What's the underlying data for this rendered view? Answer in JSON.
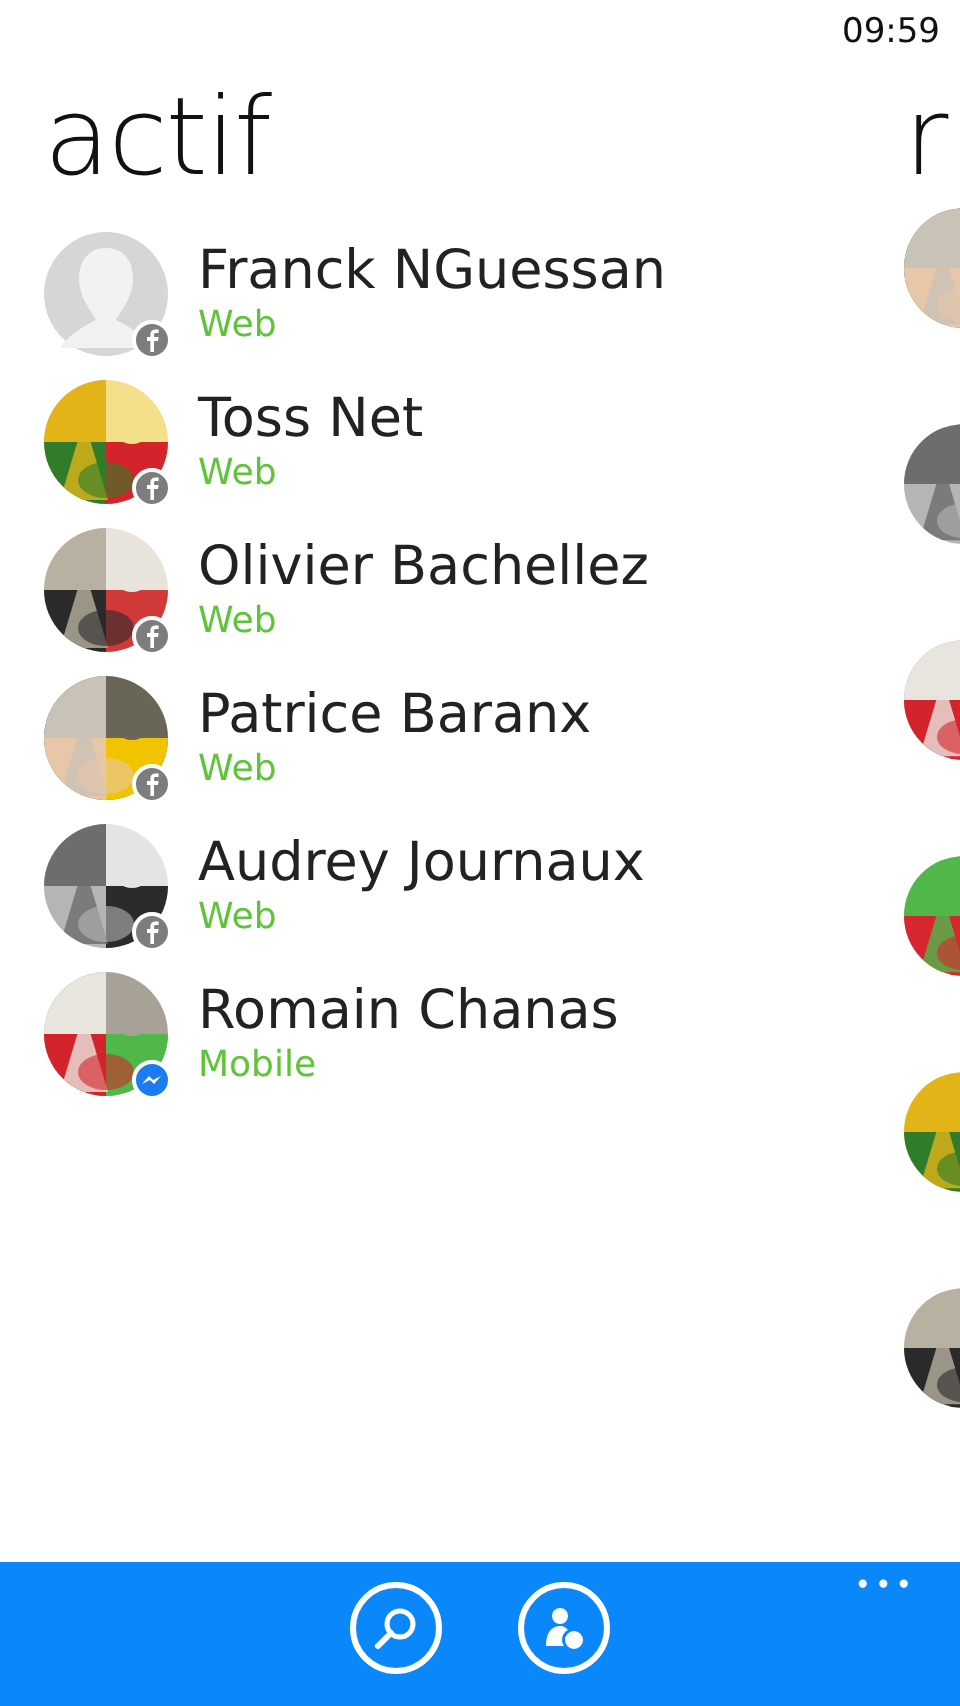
{
  "status_bar": {
    "time": "09:59"
  },
  "pivots": [
    {
      "header": "actif",
      "contacts": [
        {
          "name": "Franck NGuessan",
          "presence": "Web",
          "avatar": {
            "kind": "placeholder"
          },
          "badge": {
            "kind": "facebook"
          }
        },
        {
          "name": "Toss Net",
          "presence": "Web",
          "badge": {
            "kind": "facebook"
          }
        },
        {
          "name": "Olivier Bachellez",
          "presence": "Web",
          "badge": {
            "kind": "facebook"
          }
        },
        {
          "name": "Patrice Baranx",
          "presence": "Web",
          "badge": {
            "kind": "facebook"
          }
        },
        {
          "name": "Audrey Journaux",
          "presence": "Web",
          "badge": {
            "kind": "facebook"
          }
        },
        {
          "name": "Romain Chanas",
          "presence": "Mobile",
          "badge": {
            "kind": "messenger"
          }
        }
      ]
    },
    {
      "header": "r"
    }
  ],
  "app_bar": {
    "buttons": [
      {
        "kind": "search"
      },
      {
        "kind": "add-contact"
      }
    ],
    "more": "•••"
  }
}
